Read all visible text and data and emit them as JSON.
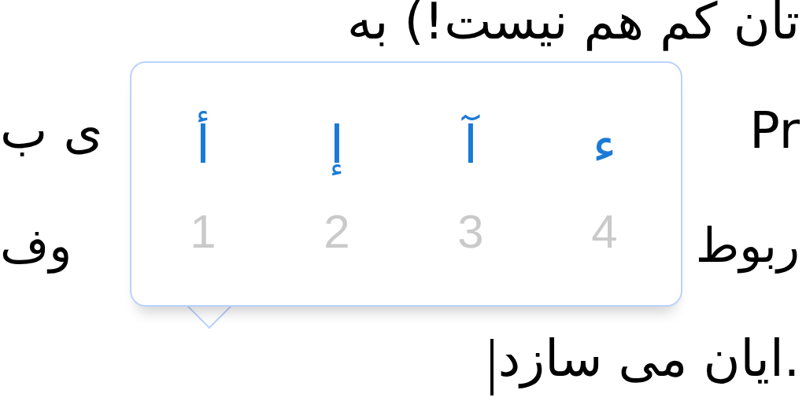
{
  "document_lines": [
    {
      "right": "تان کم هم نیست!) به"
    },
    {
      "left": "ی ب",
      "right": "Pr"
    },
    {
      "left": "وف",
      "right": "ربوط"
    },
    {
      "right": "ایان می سازد.",
      "caret": true
    }
  ],
  "accent_popup": {
    "options": [
      {
        "character": "ء",
        "number": "4",
        "selected": false
      },
      {
        "character": "آ",
        "number": "3",
        "selected": false
      },
      {
        "character": "إ",
        "number": "2",
        "selected": false
      },
      {
        "character": "أ",
        "number": "1",
        "selected": false
      }
    ]
  }
}
